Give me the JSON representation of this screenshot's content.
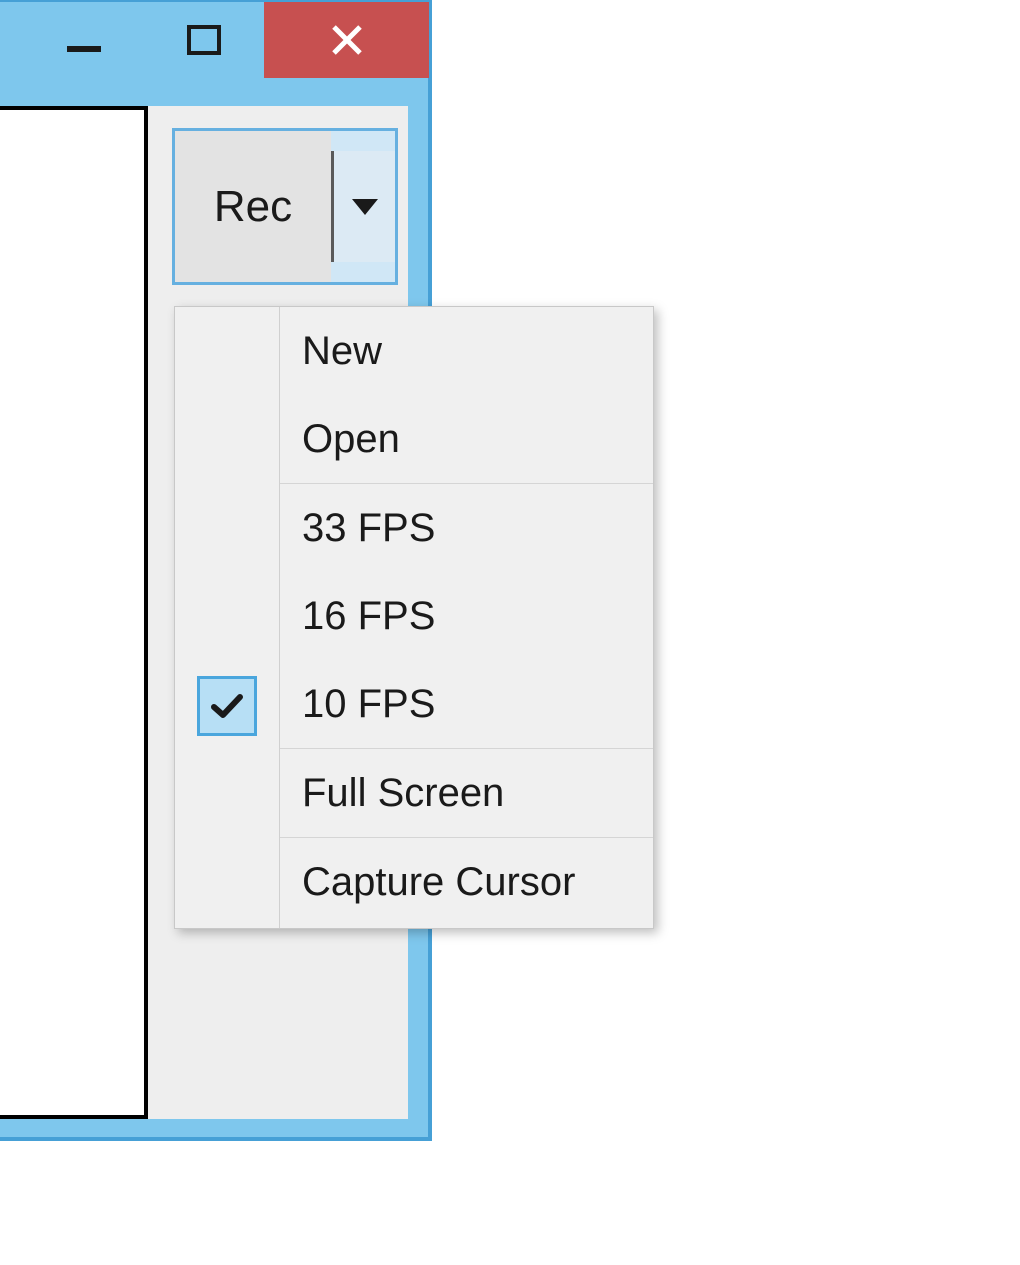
{
  "toolbar": {
    "rec_label": "Rec"
  },
  "menu": {
    "items": {
      "new": "New",
      "open": "Open",
      "fps33": "33 FPS",
      "fps16": "16 FPS",
      "fps10": "10 FPS",
      "fullscreen": "Full Screen",
      "capture_cursor": "Capture Cursor"
    },
    "checked": "fps10"
  }
}
